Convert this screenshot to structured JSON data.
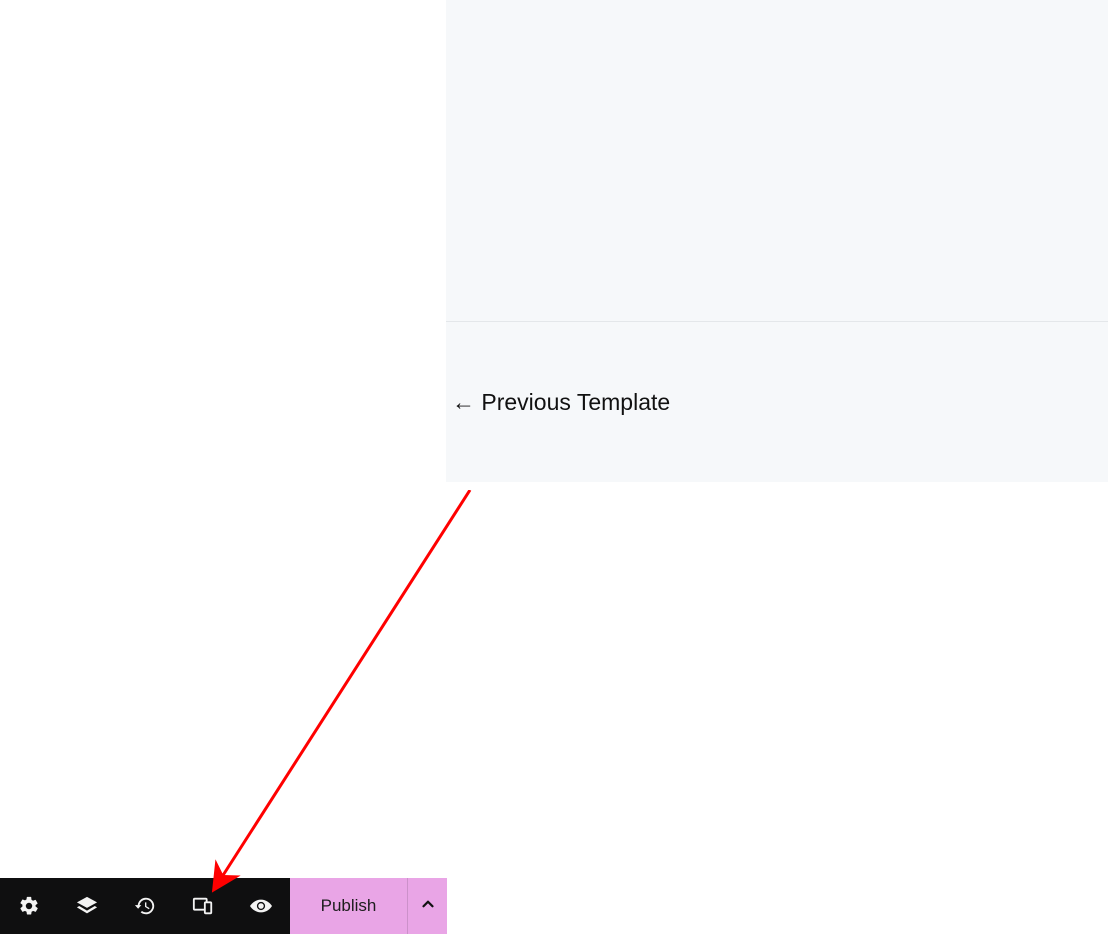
{
  "link": {
    "label": "← Previous Template"
  },
  "toolbar": {
    "publish_label": "Publish",
    "icons": {
      "settings": "gear-icon",
      "layers": "layers-icon",
      "history": "history-icon",
      "responsive": "responsive-icon",
      "preview": "eye-icon"
    }
  },
  "annotation": {
    "type": "arrow",
    "color": "#ff0000",
    "points_to": "responsive-icon"
  }
}
